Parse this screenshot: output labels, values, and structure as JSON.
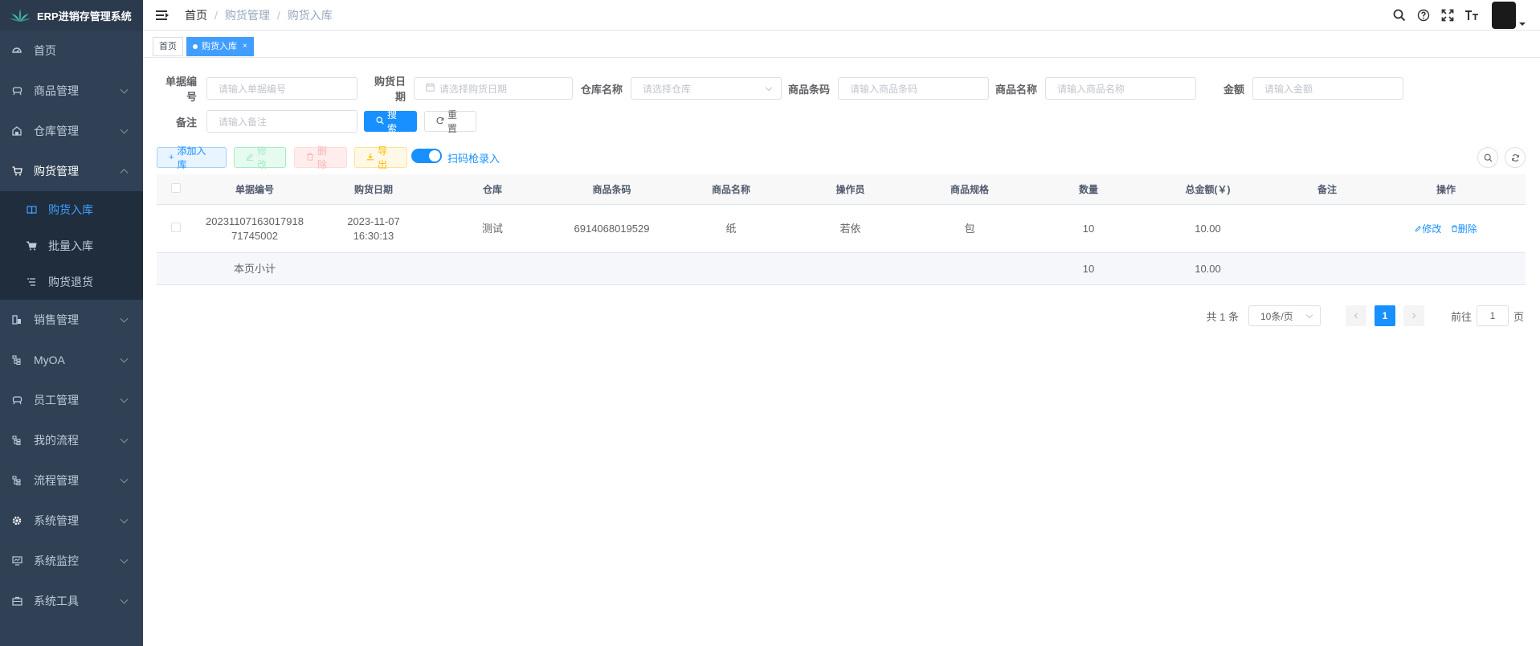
{
  "app": {
    "title": "ERP进销存管理系统"
  },
  "sidebar": {
    "items": [
      {
        "label": "首页",
        "icon": "dashboard-icon"
      },
      {
        "label": "商品管理",
        "icon": "guide-icon"
      },
      {
        "label": "仓库管理",
        "icon": "warehouse-icon"
      },
      {
        "label": "购货管理",
        "icon": "cart-icon"
      },
      {
        "label": "销售管理",
        "icon": "sales-icon"
      },
      {
        "label": "MyOA",
        "icon": "tree-icon"
      },
      {
        "label": "员工管理",
        "icon": "guide-icon"
      },
      {
        "label": "我的流程",
        "icon": "tree-icon"
      },
      {
        "label": "流程管理",
        "icon": "tree-icon"
      },
      {
        "label": "系统管理",
        "icon": "gear-icon"
      },
      {
        "label": "系统监控",
        "icon": "monitor-icon"
      },
      {
        "label": "系统工具",
        "icon": "tool-icon"
      }
    ],
    "submenu": [
      {
        "label": "购货入库",
        "icon": "book-icon"
      },
      {
        "label": "批量入库",
        "icon": "cart-icon"
      },
      {
        "label": "购货退货",
        "icon": "list-icon"
      }
    ]
  },
  "breadcrumb": {
    "home": "首页",
    "parent": "购货管理",
    "current": "购货入库"
  },
  "tags": {
    "home": "首页",
    "active": "购货入库",
    "close": "×"
  },
  "search": {
    "order_no": {
      "label": "单据编号",
      "placeholder": "请输入单据编号"
    },
    "date": {
      "label": "购货日期",
      "placeholder": "请选择购货日期"
    },
    "warehouse": {
      "label": "仓库名称",
      "placeholder": "请选择仓库"
    },
    "barcode": {
      "label": "商品条码",
      "placeholder": "请输入商品条码"
    },
    "product": {
      "label": "商品名称",
      "placeholder": "请输入商品名称"
    },
    "amount": {
      "label": "金额",
      "placeholder": "请输入金额"
    },
    "remark": {
      "label": "备注",
      "placeholder": "请输入备注"
    },
    "search_btn": "搜索",
    "reset_btn": "重置"
  },
  "toolbar": {
    "add": "添加入库",
    "edit": "修改",
    "delete": "删除",
    "export": "导出",
    "scan_label": "扫码枪录入",
    "scan_on": true
  },
  "table": {
    "headers": [
      "单据编号",
      "购货日期",
      "仓库",
      "商品条码",
      "商品名称",
      "操作员",
      "商品规格",
      "数量",
      "总金额(￥)",
      "备注",
      "操作"
    ],
    "rows": [
      {
        "order_no": "2023110716301791871745002",
        "date_line1": "2023-11-07",
        "date_line2": "16:30:13",
        "warehouse": "测试",
        "barcode": "6914068019529",
        "product": "纸",
        "operator": "若依",
        "spec": "包",
        "qty": "10",
        "total": "10.00",
        "remark": "",
        "edit": "修改",
        "delete": "删除"
      }
    ],
    "subtotal": {
      "label": "本页小计",
      "qty": "10",
      "total": "10.00"
    }
  },
  "pagination": {
    "total": "共 1 条",
    "page_size": "10条/页",
    "current": "1",
    "goto_label": "前往",
    "goto_value": "1",
    "page_suffix": "页"
  },
  "colors": {
    "sidebar_bg": "#304156",
    "accent": "#1890ff",
    "active_menu": "#409eff"
  }
}
